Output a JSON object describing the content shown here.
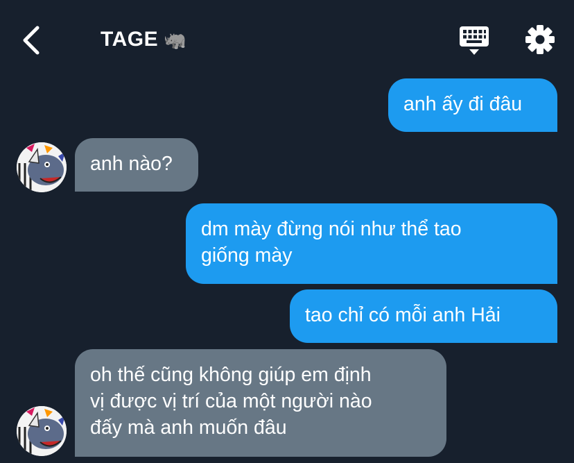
{
  "header": {
    "title": "TAGE",
    "title_emoji": "🦏",
    "icons": {
      "back": "chevron-left-icon",
      "keyboard": "keyboard-icon",
      "settings": "gear-icon"
    }
  },
  "messages": [
    {
      "direction": "out",
      "text": "anh ấy đi đâu"
    },
    {
      "direction": "in",
      "text": "anh nào?"
    },
    {
      "direction": "out",
      "lines": [
        "dm mày đừng nói như thể tao",
        "giống mày"
      ]
    },
    {
      "direction": "out",
      "text": "tao chỉ có mỗi anh Hải"
    },
    {
      "direction": "in",
      "lines": [
        "oh thế cũng không giúp em định",
        "vị được vị trí của một người nào",
        "đấy mà anh muốn đâu"
      ]
    }
  ],
  "colors": {
    "background": "#17202d",
    "outgoing": "#1d9bf0",
    "incoming": "#677785",
    "text": "#ffffff"
  }
}
